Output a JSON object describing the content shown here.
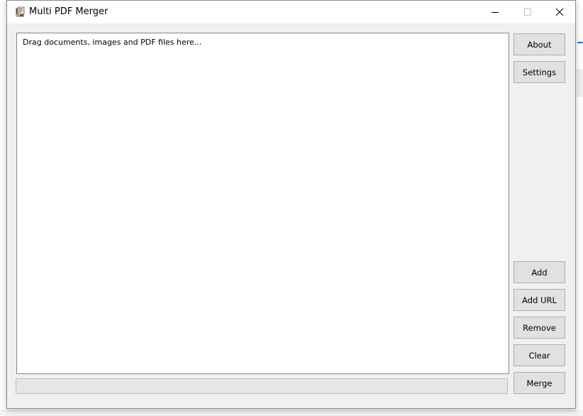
{
  "window": {
    "title": "Multi PDF Merger",
    "icon": "pdf-merger-app-icon"
  },
  "window_controls": {
    "minimize_icon": "minimize-icon",
    "maximize_icon": "maximize-icon",
    "close_icon": "close-icon"
  },
  "file_list": {
    "hint": "Drag documents, images and PDF files here..."
  },
  "buttons": {
    "about": "About",
    "settings": "Settings",
    "add": "Add",
    "add_url": "Add URL",
    "remove": "Remove",
    "clear": "Clear",
    "merge": "Merge"
  },
  "progress": {
    "value": 0
  },
  "colors": {
    "window_bg": "#f0f0f0",
    "button_bg": "#e1e1e1",
    "button_border": "#adadad",
    "accent": "#2b6fd6"
  }
}
